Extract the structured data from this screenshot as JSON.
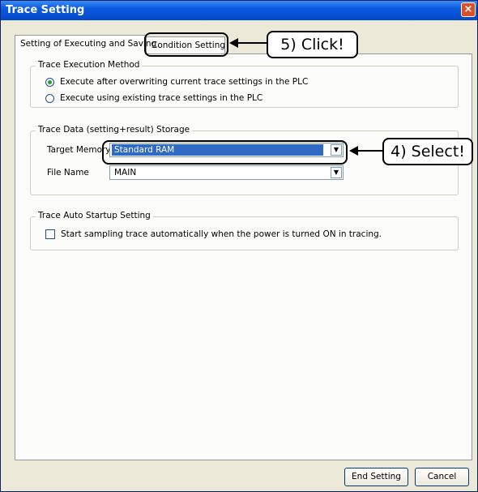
{
  "window": {
    "title": "Trace Setting",
    "close_glyph": "×"
  },
  "tabs": [
    {
      "label": "Setting of Executing and Saving"
    },
    {
      "label": "Condition Setting"
    }
  ],
  "execution_method": {
    "title": "Trace Execution Method",
    "option1": "Execute after overwriting current trace settings in the PLC",
    "option2": "Execute using existing trace settings in the PLC",
    "selected": "option1"
  },
  "storage": {
    "title": "Trace Data (setting+result) Storage",
    "target_memory_label": "Target Memory",
    "target_memory_value": "Standard RAM",
    "file_name_label": "File Name",
    "file_name_value": "MAIN"
  },
  "auto_startup": {
    "title": "Trace Auto Startup Setting",
    "checkbox_label": "Start sampling trace automatically when the power is turned ON in tracing.",
    "checked": false
  },
  "buttons": {
    "end_setting": "End Setting",
    "cancel": "Cancel"
  },
  "annotations": {
    "click": "5) Click!",
    "select": "4) Select!"
  }
}
